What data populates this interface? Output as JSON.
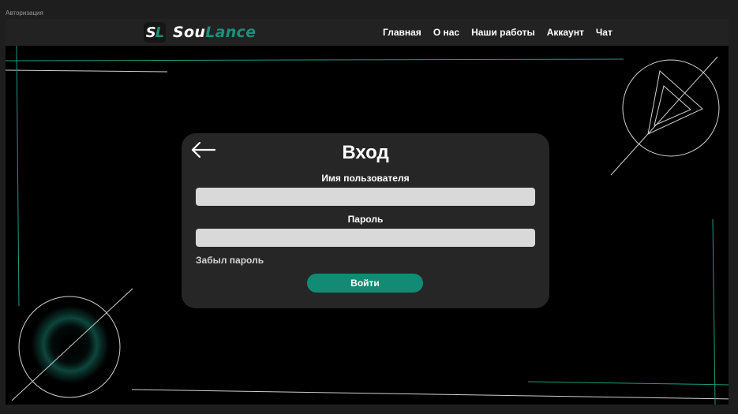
{
  "window": {
    "title": "Авторизация"
  },
  "logo": {
    "badge_s": "S",
    "badge_l": "L",
    "name_part1": "Sou",
    "name_part2": "Lance"
  },
  "nav": {
    "items": [
      "Главная",
      "О нас",
      "Наши работы",
      "Аккаунт",
      "Чат"
    ]
  },
  "login": {
    "title": "Вход",
    "username_label": "Имя пользователя",
    "username_value": "",
    "password_label": "Пароль",
    "password_value": "",
    "forgot_label": "Забыл пароль",
    "submit_label": "Войти"
  },
  "icons": {
    "back": "arrow-left-icon"
  },
  "colors": {
    "accent": "#138a73",
    "logo_accent": "#1f8f7a",
    "background": "#000000",
    "navbar": "#222222",
    "card": "#262626",
    "input": "#d9d9d9"
  }
}
